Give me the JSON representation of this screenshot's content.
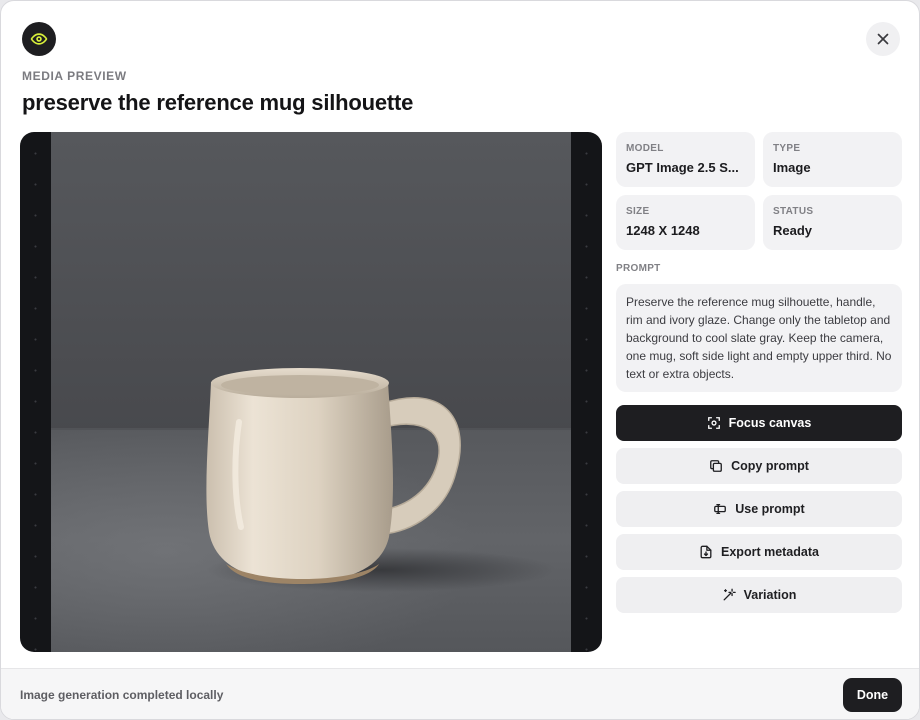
{
  "dialog": {
    "eyebrow": "MEDIA PREVIEW",
    "title": "preserve the reference mug silhouette"
  },
  "icons": {
    "header_badge": "eye-icon",
    "close": "close-icon"
  },
  "meta": [
    {
      "label": "MODEL",
      "value": "GPT Image 2.5 S..."
    },
    {
      "label": "TYPE",
      "value": "Image"
    },
    {
      "label": "SIZE",
      "value": "1248 X 1248"
    },
    {
      "label": "STATUS",
      "value": "Ready"
    }
  ],
  "prompt": {
    "label": "PROMPT",
    "text": "Preserve the reference mug silhouette, handle, rim and ivory glaze. Change only the tabletop and background to cool slate gray. Keep the camera, one mug, soft side light and empty upper third. No text or extra objects."
  },
  "actions": [
    {
      "label": "Focus canvas",
      "icon": "focus-icon"
    },
    {
      "label": "Copy prompt",
      "icon": "copy-icon"
    },
    {
      "label": "Use prompt",
      "icon": "use-prompt-icon"
    },
    {
      "label": "Export metadata",
      "icon": "file-export-icon"
    },
    {
      "label": "Variation",
      "icon": "magic-wand-icon"
    }
  ],
  "footer": {
    "status": "Image generation completed locally",
    "done_label": "Done"
  },
  "colors": {
    "accent_dark": "#1e1e21",
    "badge_icon": "#d8f03a",
    "card_bg": "#f2f2f4"
  }
}
